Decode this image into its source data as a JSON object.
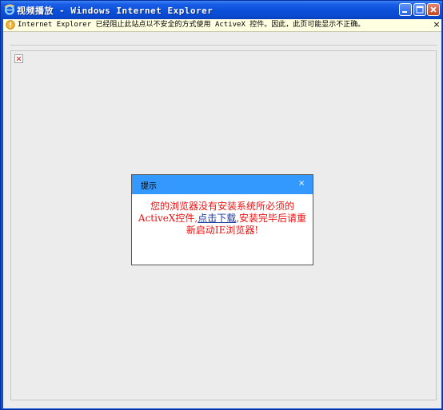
{
  "window": {
    "title": "视频播放 - Windows Internet Explorer"
  },
  "infobar": {
    "text": "Internet Explorer 已经阻止此站点以不安全的方式使用 ActiveX 控件。因此，此页可能显示不正确。",
    "close": "×"
  },
  "dialog": {
    "title": "提示",
    "close": "×",
    "message_before": "您的浏览器没有安装系统所必须的ActiveX控件,",
    "link_text": "点击下载",
    "message_after": ",安装完毕后请重新启动IE浏览器!"
  },
  "colors": {
    "title_bar": "#0a4fd6",
    "dialog_header": "#3399ff",
    "message_text": "#ee1111",
    "link": "#1a3aa0",
    "infobar": "#ffffe1"
  }
}
